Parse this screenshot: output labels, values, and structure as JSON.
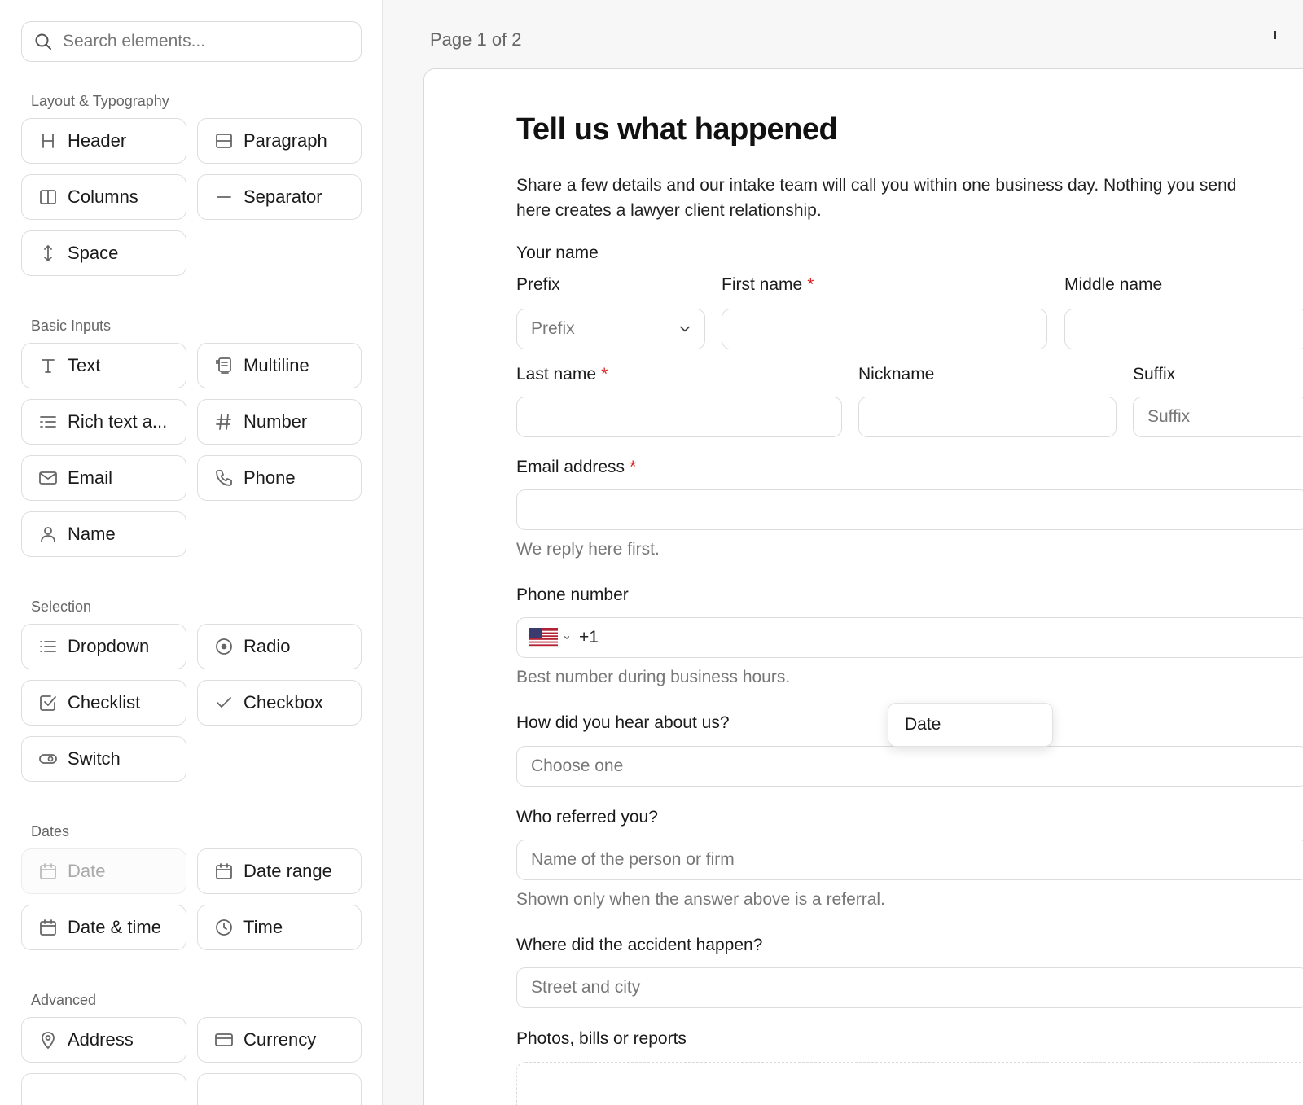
{
  "sidebar": {
    "search_placeholder": "Search elements...",
    "sections": {
      "layout": "Layout & Typography",
      "basic": "Basic Inputs",
      "selection": "Selection",
      "dates": "Dates",
      "advanced": "Advanced"
    },
    "items": {
      "header": "Header",
      "paragraph": "Paragraph",
      "columns": "Columns",
      "separator": "Separator",
      "space": "Space",
      "text": "Text",
      "multiline": "Multiline",
      "rich_text": "Rich text a...",
      "number": "Number",
      "email": "Email",
      "phone": "Phone",
      "name": "Name",
      "dropdown": "Dropdown",
      "radio": "Radio",
      "checklist": "Checklist",
      "checkbox": "Checkbox",
      "switch": "Switch",
      "date": "Date",
      "date_range": "Date range",
      "date_time": "Date & time",
      "time": "Time",
      "address": "Address",
      "currency": "Currency"
    }
  },
  "main": {
    "page_indicator": "Page 1 of 2",
    "form": {
      "title": "Tell us what happened",
      "description_line1": "Share a few details and our intake team will call you within one business day. Nothing you send",
      "description_line2": "here creates a lawyer client relationship.",
      "your_name_label": "Your name",
      "prefix_label": "Prefix",
      "prefix_placeholder": "Prefix",
      "first_name_label": "First name",
      "middle_name_label": "Middle name",
      "last_name_label": "Last name",
      "nickname_label": "Nickname",
      "suffix_label": "Suffix",
      "suffix_placeholder": "Suffix",
      "required_mark": "*",
      "email_label": "Email address",
      "email_help": "We reply here first.",
      "phone_label": "Phone number",
      "phone_code": "+1",
      "phone_help": "Best number during business hours.",
      "hear_label": "How did you hear about us?",
      "hear_placeholder": "Choose one",
      "referred_label": "Who referred you?",
      "referred_placeholder": "Name of the person or firm",
      "referred_help": "Shown only when the answer above is a referral.",
      "accident_label": "Where did the accident happen?",
      "accident_placeholder": "Street and city",
      "photos_label": "Photos, bills or reports"
    },
    "drag_tooltip": "Date"
  },
  "colors": {
    "required": "#dd2222",
    "border": "#dcdcdc",
    "muted_text": "#777777"
  }
}
